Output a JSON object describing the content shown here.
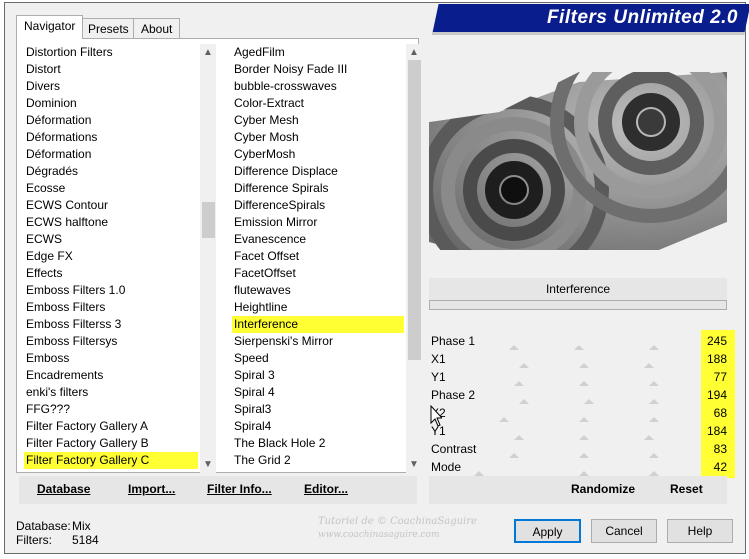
{
  "window": {
    "title": "Filters Unlimited 2.0"
  },
  "tabs": [
    {
      "label": "Navigator",
      "active": true
    },
    {
      "label": "Presets",
      "active": false
    },
    {
      "label": "About",
      "active": false
    }
  ],
  "categories": {
    "items": [
      "Distortion Filters",
      "Distort",
      "Divers",
      "Dominion",
      "Déformation",
      "Déformations",
      "Déformation",
      "Dégradés",
      "Ecosse",
      "ECWS Contour",
      "ECWS halftone",
      "ECWS",
      "Edge FX",
      "Effects",
      "Emboss Filters 1.0",
      "Emboss Filters",
      "Emboss Filterss 3",
      "Emboss Filtersys",
      "Emboss",
      "Encadrements",
      "enki's filters",
      "FFG???",
      "Filter Factory Gallery A",
      "Filter Factory Gallery B",
      "Filter Factory Gallery C"
    ],
    "selected_index": 24
  },
  "filters": {
    "items": [
      "AgedFilm",
      "Border Noisy Fade III",
      "bubble-crosswaves",
      "Color-Extract",
      "Cyber Mesh",
      "Cyber Mosh",
      "CyberMosh",
      "Difference Displace",
      "Difference Spirals",
      "DifferenceSpirals",
      "Emission Mirror",
      "Evanescence",
      "Facet Offset",
      "FacetOffset",
      "flutewaves",
      "Heightline",
      "Interference",
      "Sierpenski's Mirror",
      "Speed",
      "Spiral 3",
      "Spiral 4",
      "Spiral3",
      "Spiral4",
      "The Black Hole 2",
      "The Grid 2"
    ],
    "selected_index": 16
  },
  "left_buttons": {
    "database": "Database",
    "import": "Import...",
    "filter_info": "Filter Info...",
    "editor": "Editor..."
  },
  "selected_filter_name": "Interference",
  "params": [
    {
      "label": "Phase 1",
      "value": "245"
    },
    {
      "label": "X1",
      "value": "188"
    },
    {
      "label": "Y1",
      "value": "77"
    },
    {
      "label": "Phase 2",
      "value": "194"
    },
    {
      "label": "X2",
      "value": "68"
    },
    {
      "label": "Y1",
      "value": "184"
    },
    {
      "label": "Contrast",
      "value": "83"
    },
    {
      "label": "Mode",
      "value": "42"
    }
  ],
  "right_buttons": {
    "randomize": "Randomize",
    "reset": "Reset"
  },
  "status": {
    "database_label": "Database:",
    "database_value": "Mix",
    "filters_label": "Filters:",
    "filters_value": "5184"
  },
  "watermark": {
    "line1": "Tutoriel de © CoachinaSaguire",
    "line2": "www.coachinasaguire.com"
  },
  "dialog_buttons": {
    "apply": "Apply",
    "cancel": "Cancel",
    "help": "Help"
  },
  "colors": {
    "banner": "#0a1d8c",
    "highlight": "#ffff33",
    "accent_border": "#0078d7"
  }
}
